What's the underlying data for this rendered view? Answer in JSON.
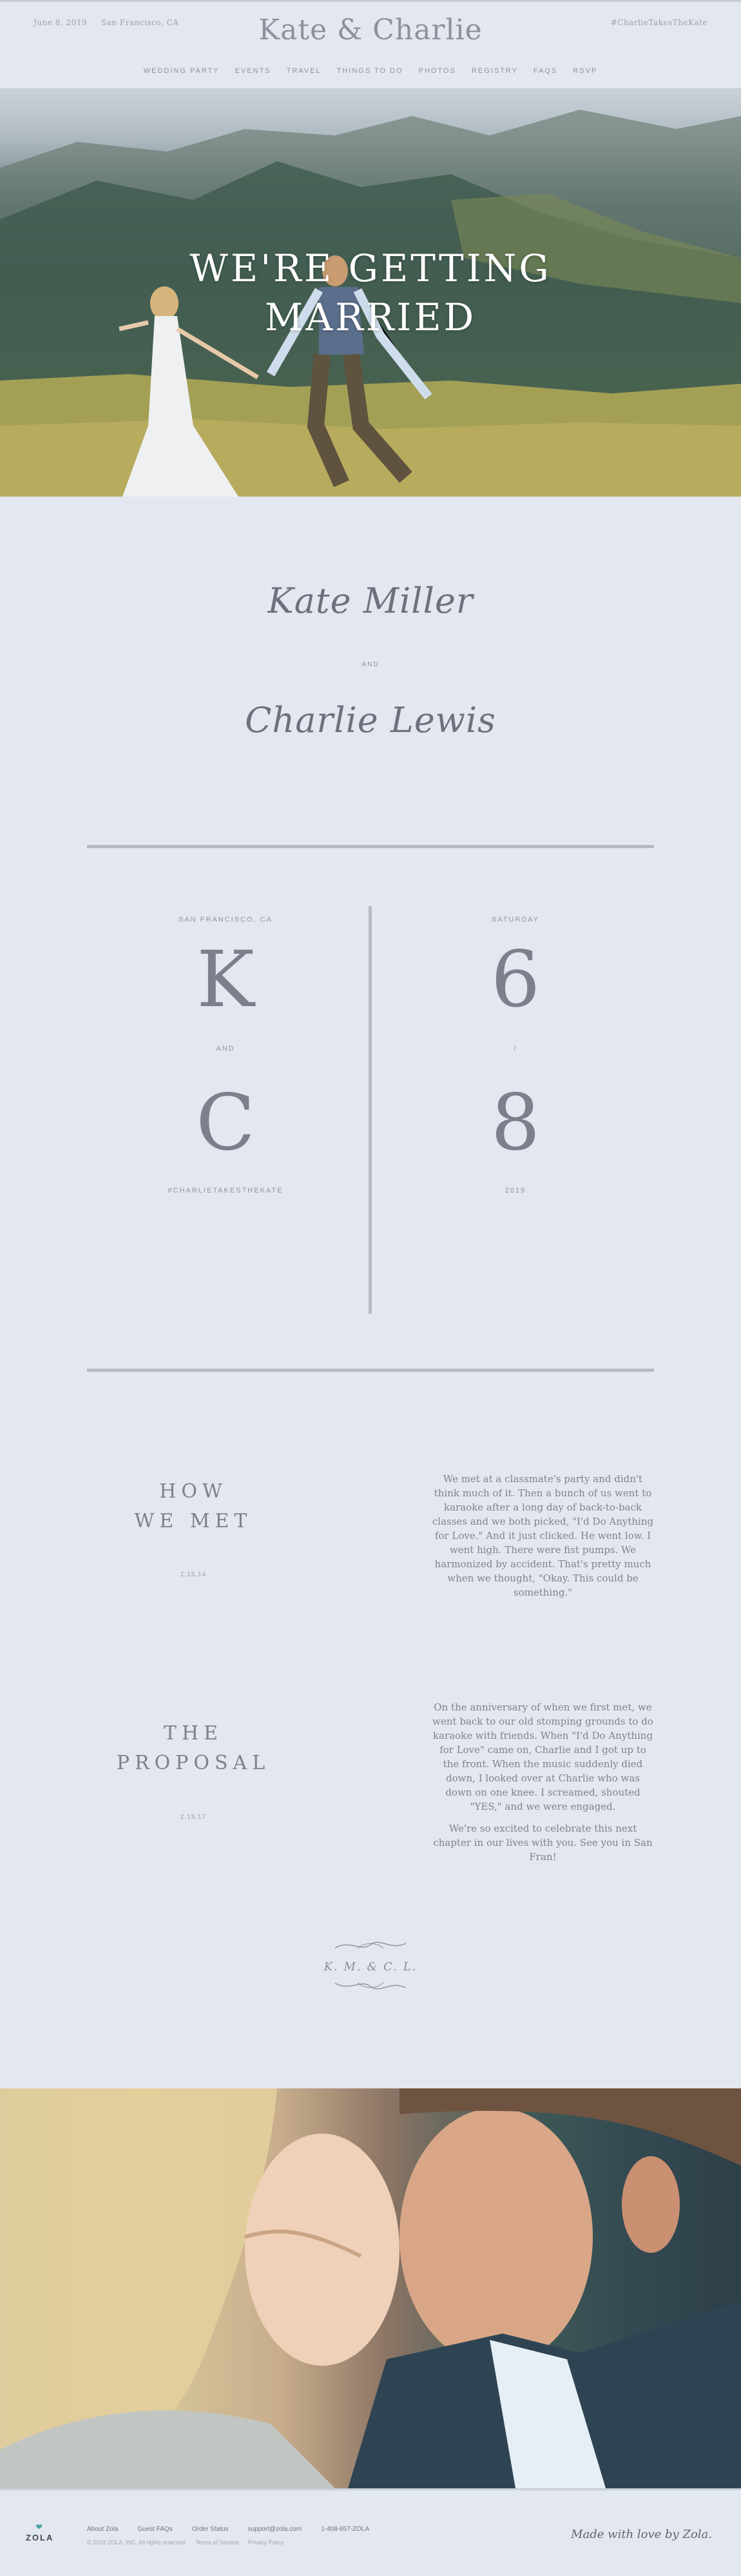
{
  "header": {
    "date": "June 8, 2019",
    "location": "San Francisco, CA",
    "title": "Kate & Charlie",
    "hashtag": "#CharlieTakesTheKate"
  },
  "nav": {
    "items": [
      "WEDDING PARTY",
      "EVENTS",
      "TRAVEL",
      "THINGS TO DO",
      "PHOTOS",
      "REGISTRY",
      "FAQS",
      "RSVP"
    ]
  },
  "hero": {
    "title_line1": "WE'RE GETTING",
    "title_line2": "MARRIED"
  },
  "couple_names": {
    "partner1": "Kate Miller",
    "and": "AND",
    "partner2": "Charlie Lewis"
  },
  "monogram_block": {
    "location": "SAN FRANCISCO, CA",
    "initial1": "K",
    "and": "AND",
    "initial2": "C",
    "hashtag": "#CHARLIETAKESTHEKATE",
    "weekday": "SATURDAY",
    "month": "6",
    "separator": "/",
    "day": "8",
    "year": "2019"
  },
  "story": {
    "how_we_met": {
      "heading_line1": "HOW",
      "heading_line2": "WE MET",
      "date": "2.15.14",
      "text": "We met at a classmate's party and didn't think much of it. Then a bunch of us went to karaoke after a long day of back-to-back classes and we both picked, \"I'd Do Anything for Love.\" And it just clicked. He went low. I went high. There were fist pumps. We harmonized by accident. That's pretty much when we thought, \"Okay. This could be something.\""
    },
    "proposal": {
      "heading_line1": "THE",
      "heading_line2": "PROPOSAL",
      "date": "2.15.17",
      "text1": "On the anniversary of when we first met, we went back to our old stomping grounds to do karaoke with friends. When \"I'd Do Anything for Love\" came on, Charlie and I got up to the front. When the music suddenly died down, I looked over at Charlie who was down on one knee. I screamed, shouted \"YES,\" and we were engaged.",
      "text2": "We're so excited to celebrate this next chapter in our lives with you. See you in San Fran!"
    }
  },
  "signature_monogram": "K. M. & C. L.",
  "footer": {
    "logo": "ZOLA",
    "links": [
      "About Zola",
      "Guest FAQs",
      "Order Status",
      "support@zola.com",
      "1-408-657-ZOLA"
    ],
    "legal": [
      "© 2018 ZOLA, INC. All rights reserved.",
      "Terms of Service",
      "Privacy Policy"
    ],
    "made_with": "Made with love by Zola."
  },
  "colors": {
    "background": "#e2e7f0",
    "text": "#7a7f8c",
    "rule": "#b3bac6",
    "zola_accent": "#4aa6a0"
  }
}
